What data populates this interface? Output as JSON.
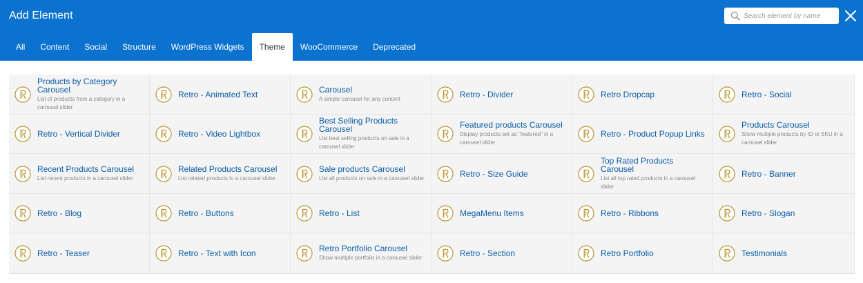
{
  "title": "Add Element",
  "search": {
    "placeholder": "Search element by name"
  },
  "tabs": [
    "All",
    "Content",
    "Social",
    "Structure",
    "WordPress Widgets",
    "Theme",
    "WooCommerce",
    "Deprecated"
  ],
  "active_tab": "Theme",
  "colors": {
    "header": "#0b73cf",
    "link": "#0b5ea8",
    "icon_gold": "#b8952f"
  },
  "elements": [
    {
      "name": "Products by Category Carousel",
      "desc": "List of products from a category in a carousel slider"
    },
    {
      "name": "Retro - Animated Text",
      "desc": ""
    },
    {
      "name": "Carousel",
      "desc": "A simple carousel for any content"
    },
    {
      "name": "Retro - Divider",
      "desc": ""
    },
    {
      "name": "Retro Dropcap",
      "desc": ""
    },
    {
      "name": "Retro - Social",
      "desc": ""
    },
    {
      "name": "Retro - Vertical Divider",
      "desc": ""
    },
    {
      "name": "Retro - Video Lightbox",
      "desc": ""
    },
    {
      "name": "Best Selling Products Carousel",
      "desc": "List best selling products on sale in a carousel slider"
    },
    {
      "name": "Featured products Carousel",
      "desc": "Display products set as \"featured\" in a carousel slider"
    },
    {
      "name": "Retro - Product Popup Links",
      "desc": ""
    },
    {
      "name": "Products Carousel",
      "desc": "Show multiple products by ID or SKU in a carousel slider"
    },
    {
      "name": "Recent Products Carousel",
      "desc": "List recent products in a carousel slider"
    },
    {
      "name": "Related Products Carousel",
      "desc": "List related products in a carousel slider"
    },
    {
      "name": "Sale products Carousel",
      "desc": "List all products on sale in a carousel slider"
    },
    {
      "name": "Retro - Size Guide",
      "desc": ""
    },
    {
      "name": "Top Rated Products Carousel",
      "desc": "List all top rated products in a carousel slider"
    },
    {
      "name": "Retro - Banner",
      "desc": ""
    },
    {
      "name": "Retro - Blog",
      "desc": ""
    },
    {
      "name": "Retro - Buttons",
      "desc": ""
    },
    {
      "name": "Retro - List",
      "desc": ""
    },
    {
      "name": "MegaMenu Items",
      "desc": ""
    },
    {
      "name": "Retro - Ribbons",
      "desc": ""
    },
    {
      "name": "Retro - Slogan",
      "desc": ""
    },
    {
      "name": "Retro - Teaser",
      "desc": ""
    },
    {
      "name": "Retro - Text with Icon",
      "desc": ""
    },
    {
      "name": "Retro Portfolio Carousel",
      "desc": "Show multiple portfolio in a carousel slider"
    },
    {
      "name": "Retro - Section",
      "desc": ""
    },
    {
      "name": "Retro Portfolio",
      "desc": ""
    },
    {
      "name": "Testimonials",
      "desc": ""
    }
  ]
}
